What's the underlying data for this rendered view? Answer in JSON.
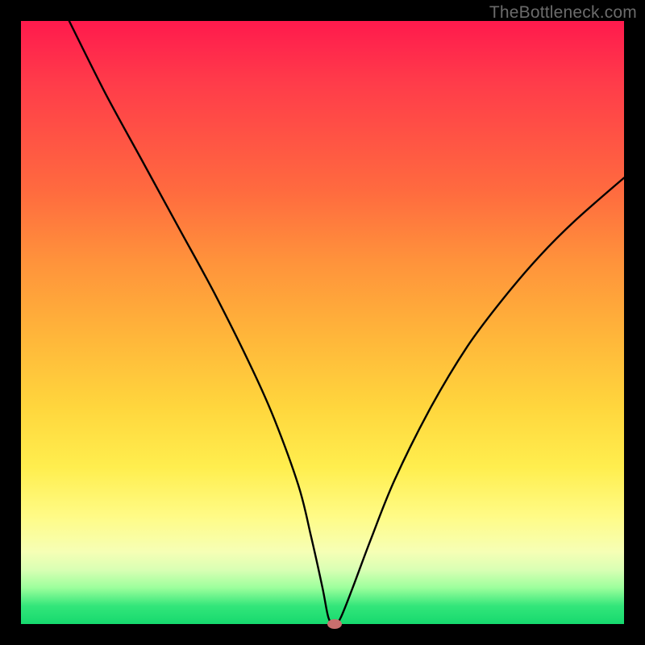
{
  "watermark": "TheBottleneck.com",
  "chart_data": {
    "type": "line",
    "title": "",
    "xlabel": "",
    "ylabel": "",
    "xlim": [
      0,
      100
    ],
    "ylim": [
      0,
      100
    ],
    "x": [
      8,
      14,
      20,
      26,
      32,
      38,
      42,
      46,
      48,
      50,
      51,
      52,
      53,
      55,
      58,
      62,
      68,
      74,
      80,
      86,
      92,
      100
    ],
    "y": [
      100,
      88,
      77,
      66,
      55,
      43,
      34,
      23,
      15,
      6,
      1,
      0,
      1,
      6,
      14,
      24,
      36,
      46,
      54,
      61,
      67,
      74
    ],
    "series_name": "bottleneck-curve",
    "marker": {
      "x": 52,
      "y": 0,
      "color": "#c86e6e",
      "rx": 9,
      "ry": 6
    },
    "gradient_stops": [
      {
        "pos": 0,
        "color": "#ff1a4d"
      },
      {
        "pos": 28,
        "color": "#ff6a3f"
      },
      {
        "pos": 52,
        "color": "#ffb53a"
      },
      {
        "pos": 74,
        "color": "#ffee4e"
      },
      {
        "pos": 91,
        "color": "#d9ffb4"
      },
      {
        "pos": 100,
        "color": "#16d96e"
      }
    ]
  }
}
